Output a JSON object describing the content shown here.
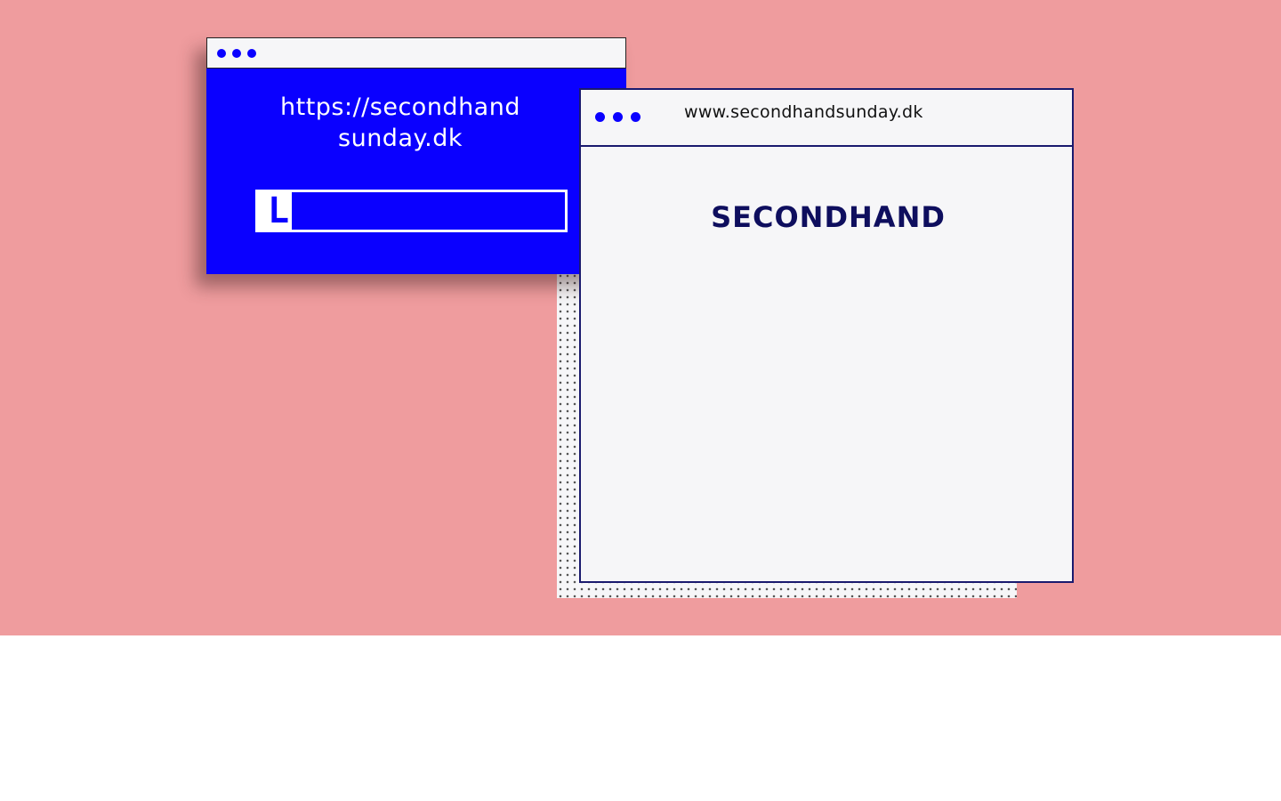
{
  "back_window": {
    "url_text": "https://secondhand\nsunday.dk",
    "progress_fraction": 0.11,
    "progress_glyph": "L"
  },
  "front_window": {
    "url": "www.secondhandsunday.dk",
    "site_title": "SECONDHAND"
  },
  "colors": {
    "background": "#ef9c9e",
    "accent_blue": "#0a00ff",
    "window_bg": "#f6f6f8",
    "navy": "#0e0e5e"
  }
}
